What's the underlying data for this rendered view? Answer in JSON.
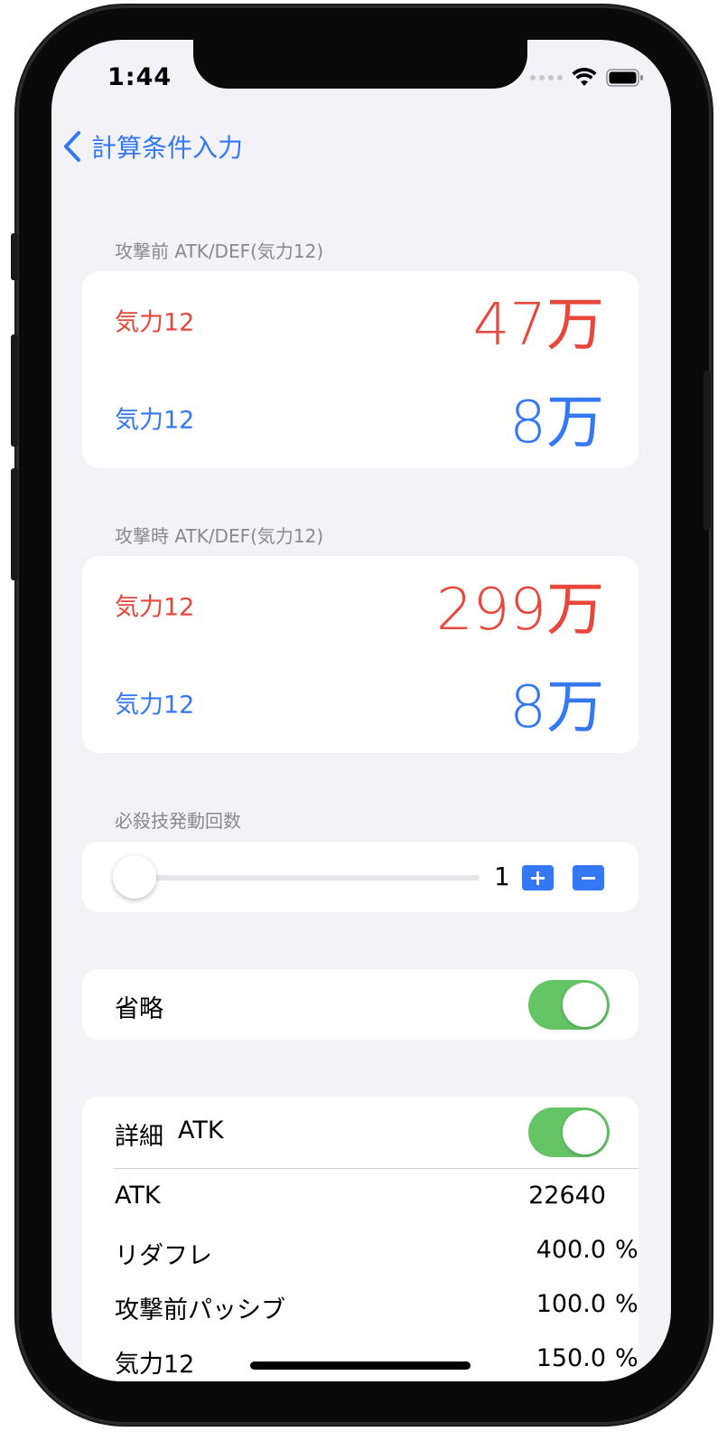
{
  "status_bar": {
    "time": "1:44"
  },
  "nav": {
    "back_label": "計算条件入力"
  },
  "before_attack": {
    "header": "攻撃前 ATK/DEF(気力12)",
    "atk_label": "気力12",
    "atk_value": "47万",
    "def_label": "気力12",
    "def_value": "8万"
  },
  "during_attack": {
    "header": "攻撃時 ATK/DEF(気力12)",
    "atk_label": "気力12",
    "atk_value": "299万",
    "def_label": "気力12",
    "def_value": "8万"
  },
  "special_count": {
    "header": "必殺技発動回数",
    "value": "1",
    "plus": "+",
    "minus": "−"
  },
  "omit": {
    "label": "省略",
    "on": true
  },
  "detail": {
    "label": "詳細",
    "mode": "ATK",
    "on": true,
    "rows": [
      {
        "label": "ATK",
        "value": "22640",
        "unit": ""
      },
      {
        "label": "リダフレ",
        "value": "400.0",
        "unit": "%"
      },
      {
        "label": "攻撃前パッシブ",
        "value": "100.0",
        "unit": "%"
      },
      {
        "label": "気力12",
        "value": "150.0",
        "unit": "%"
      }
    ]
  },
  "colors": {
    "red": "#e8473c",
    "blue": "#3478f6",
    "green": "#65c466",
    "background": "#f2f2f7"
  }
}
